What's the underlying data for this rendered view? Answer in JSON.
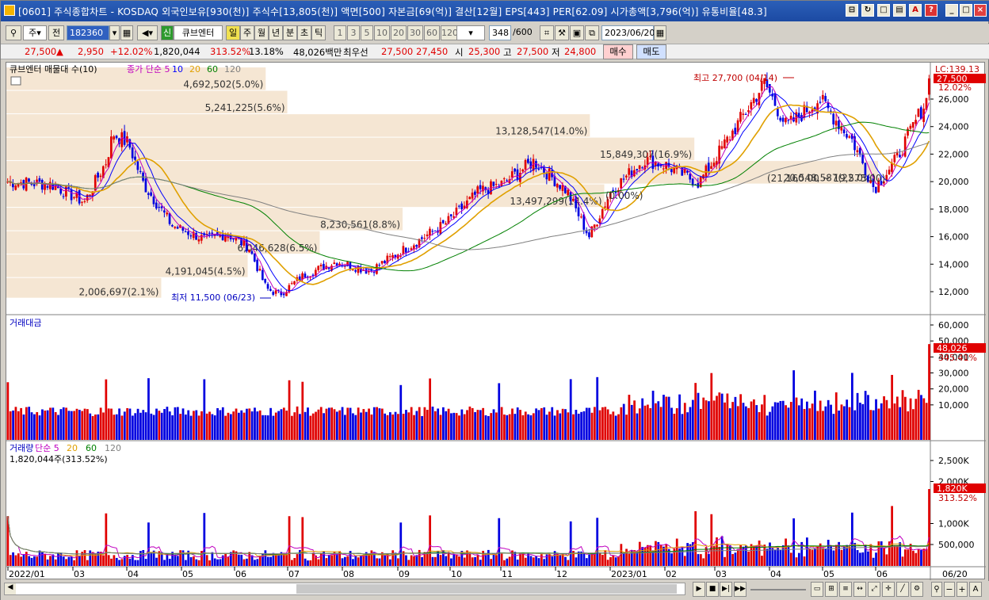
{
  "title": "[0601] 주식종합차트 - KOSDAQ 외국인보유[930(천)] 주식수[13,805(천)] 액면[500] 자본금[69(억)] 결산[12월] EPS[443] PER[62.09] 시가총액[3,796(억)] 유통비율[48.3]",
  "toolbar": {
    "type_select": "주",
    "prev_label": "전",
    "code": "182360",
    "new_label": "신",
    "cube_label": "큐브엔터",
    "periods": [
      "일",
      "주",
      "월",
      "년",
      "분",
      "초",
      "틱"
    ],
    "active_period": "일",
    "intervals": [
      "1",
      "3",
      "5",
      "10",
      "20",
      "30",
      "60",
      "120"
    ],
    "count": "348",
    "count_total": "/600",
    "date": "2023/06/20"
  },
  "quote": {
    "price": "27,500",
    "change": "2,950",
    "change_pct": "+12.02%",
    "volume": "1,820,044",
    "volume_ratio": "313.52%",
    "turnover": "13.18%",
    "amount": "48,026백만",
    "best_label": "최우선",
    "ask": "27,500",
    "bid": "27,450",
    "open_label": "시",
    "open": "25,300",
    "high_label": "고",
    "high": "27,500",
    "low_label": "저",
    "low": "24,800",
    "buy_label": "매수",
    "sell_label": "매도"
  },
  "price_panel": {
    "legend": [
      "큐브엔터 매물대 수(10)",
      "종가 단순 5",
      "10",
      "20",
      "60",
      "120"
    ],
    "legend_colors": [
      "#000000",
      "#c000c0",
      "#0000ff",
      "#e0a000",
      "#008000",
      "#808080"
    ],
    "lc_label": "LC:139.13",
    "last_price": "27,500",
    "last_pct": "12.02%",
    "max_label": "최고 27,700 (04/14)",
    "min_label": "최저 11,500 (06/23)",
    "range_label": "(21,160.00 ~ 19,575.00)",
    "marker_label": "(0.00%)",
    "y_ticks": [
      "26,000",
      "24,000",
      "22,000",
      "20,000",
      "18,000",
      "16,000",
      "14,000",
      "12,000"
    ],
    "volume_profile": [
      {
        "label": "2,006,697(2.1%)"
      },
      {
        "label": "4,191,045(4.5%)"
      },
      {
        "label": "6,046,628(6.5%)"
      },
      {
        "label": "8,230,561(8.8%)"
      },
      {
        "label": "13,497,299(14.4%)"
      },
      {
        "label": "20,548,587(22.0%)"
      },
      {
        "label": "15,849,307(16.9%)"
      },
      {
        "label": "13,128,547(14.0%)"
      },
      {
        "label": "5,241,225(5.6%)"
      },
      {
        "label": "4,692,502(5.0%)"
      }
    ]
  },
  "amount_panel": {
    "title": "거래대금",
    "last_value": "48,026",
    "last_pct": "345.41%",
    "y_ticks": [
      "60,000",
      "50,000",
      "40,000",
      "30,000",
      "20,000",
      "10,000"
    ]
  },
  "volume_panel": {
    "title": "거래량 단순 5 20 60 120",
    "title_parts": [
      "거래량",
      "단순 5",
      "20",
      "60",
      "120"
    ],
    "subtitle": "1,820,044주(313.52%)",
    "last_value": "1,820K",
    "last_pct": "313.52%",
    "y_ticks": [
      "2,500K",
      "2,000K",
      "1,000K",
      "500,000"
    ]
  },
  "x_labels": [
    "2022/01",
    "03",
    "04",
    "05",
    "06",
    "07",
    "08",
    "09",
    "10",
    "11",
    "12",
    "2023/01",
    "02",
    "03",
    "04",
    "05",
    "06",
    "06/20"
  ],
  "colors": {
    "up": "#e00000",
    "down": "#0000e0",
    "ma5": "#c000c0",
    "ma10": "#0000ff",
    "ma20": "#e0a000",
    "ma60": "#008000",
    "ma120": "#808080",
    "profile": "#f5e6d3"
  }
}
